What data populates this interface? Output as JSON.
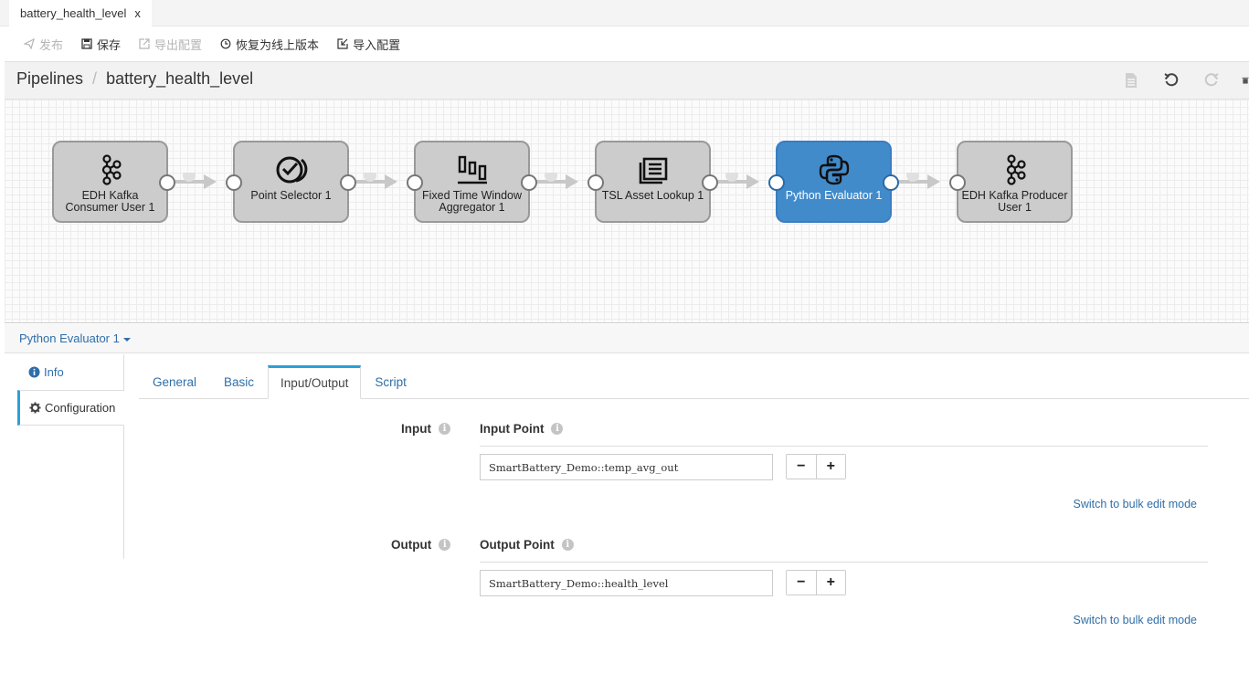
{
  "tab": {
    "title": "battery_health_level",
    "close_label": "x"
  },
  "toolbar": {
    "publish_label": "发布",
    "save_label": "保存",
    "export_label": "导出配置",
    "restore_label": "恢复为线上版本",
    "import_label": "导入配置"
  },
  "breadcrumb": {
    "root": "Pipelines",
    "separator": "/",
    "current": "battery_health_level"
  },
  "pipeline": {
    "nodes": [
      {
        "label": "EDH Kafka Consumer User 1",
        "icon": "kafka-icon",
        "active": false
      },
      {
        "label": "Point Selector 1",
        "icon": "point-selector-icon",
        "active": false
      },
      {
        "label": "Fixed Time Window Aggregator 1",
        "icon": "aggregator-icon",
        "active": false
      },
      {
        "label": "TSL Asset Lookup 1",
        "icon": "asset-lookup-icon",
        "active": false
      },
      {
        "label": "Python Evaluator 1",
        "icon": "python-icon",
        "active": true
      },
      {
        "label": "EDH Kafka Producer User 1",
        "icon": "kafka-icon",
        "active": false
      }
    ]
  },
  "stage_selector": {
    "label": "Python Evaluator 1"
  },
  "side_tabs": {
    "info": "Info",
    "configuration": "Configuration"
  },
  "config_tabs": {
    "general": "General",
    "basic": "Basic",
    "io": "Input/Output",
    "script": "Script"
  },
  "input": {
    "section_label": "Input",
    "point_label": "Input Point",
    "value": "SmartBattery_Demo::temp_avg_out",
    "bulk_link": "Switch to bulk edit mode"
  },
  "output": {
    "section_label": "Output",
    "point_label": "Output Point",
    "value": "SmartBattery_Demo::health_level",
    "bulk_link": "Switch to bulk edit mode"
  },
  "stepper": {
    "minus": "−",
    "plus": "+"
  },
  "info_glyph": "i",
  "colors": {
    "accent": "#428bca",
    "link": "#2f6ea8",
    "tab_highlight": "#2aa0d8",
    "node_fill": "#cccccc"
  }
}
